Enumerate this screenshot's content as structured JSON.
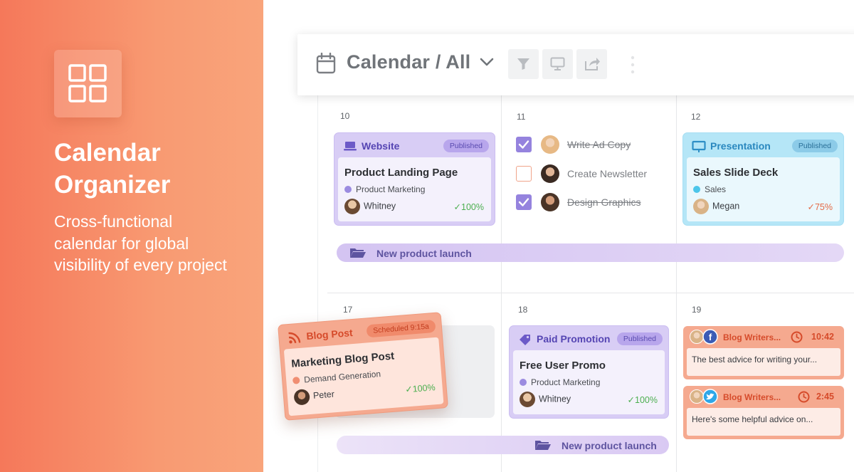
{
  "hero": {
    "logo_icon": "grid-icon",
    "title": "Calendar Organizer",
    "subtitle": "Cross-functional calendar for global visibility of every project"
  },
  "toolbar": {
    "title": "Calendar / All",
    "icons": [
      "calendar-icon",
      "chevron-down-icon",
      "filter-icon",
      "monitor-icon",
      "share-icon",
      "more-vertical-icon"
    ]
  },
  "days": [
    "10",
    "11",
    "12",
    "17",
    "18",
    "19"
  ],
  "cards": {
    "website": {
      "type_label": "Website",
      "badge": "Published",
      "title": "Product Landing Page",
      "category": "Product Marketing",
      "person": "Whitney",
      "progress": "100%",
      "accent": "#7d6ad6"
    },
    "presentation": {
      "type_label": "Presentation",
      "badge": "Published",
      "title": "Sales Slide Deck",
      "category": "Sales",
      "person": "Megan",
      "progress": "75%",
      "accent": "#3aa3d6"
    },
    "blog": {
      "type_label": "Blog Post",
      "badge": "Scheduled 9:15a",
      "title": "Marketing Blog Post",
      "category": "Demand Generation",
      "person": "Peter",
      "progress": "100%",
      "accent": "#e0593a"
    },
    "paid": {
      "type_label": "Paid Promotion",
      "badge": "Published",
      "title": "Free User Promo",
      "category": "Product Marketing",
      "person": "Whitney",
      "progress": "100%",
      "accent": "#7d6ad6"
    }
  },
  "tasks": [
    {
      "label": "Write Ad Copy",
      "done": true
    },
    {
      "label": "Create Newsletter",
      "done": false
    },
    {
      "label": "Design Graphics",
      "done": true
    }
  ],
  "banners": {
    "week1": "New product launch",
    "week2": "New product launch"
  },
  "social": [
    {
      "name": "Blog Writers...",
      "network": "facebook-icon",
      "time": "10:42",
      "text": "The best advice for writing your..."
    },
    {
      "name": "Blog Writers...",
      "network": "twitter-icon",
      "time": "2:45",
      "text": "Here's some helpful advice on..."
    }
  ]
}
